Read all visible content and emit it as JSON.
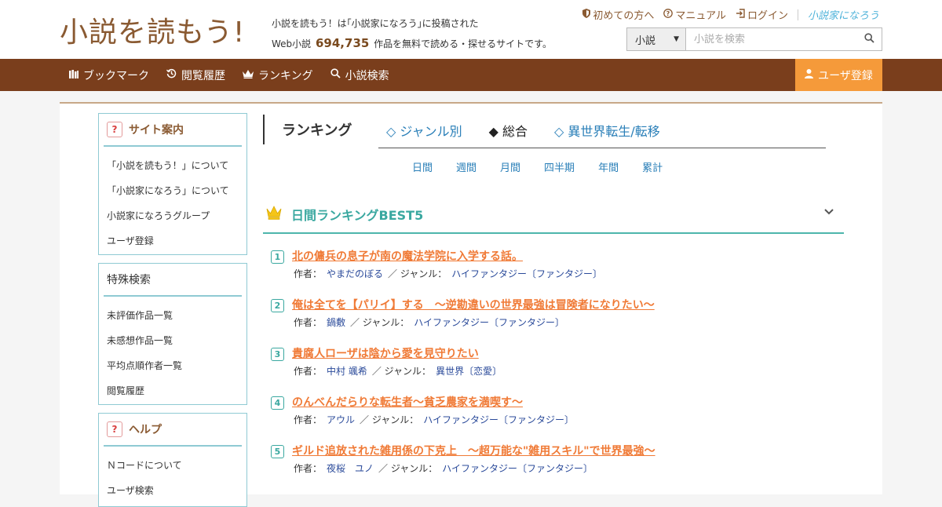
{
  "header": {
    "logo": "小説を読もう!",
    "tagline_line1": "小説を読もう！は｢小説家になろう｣に投稿された",
    "tagline_prefix": "Web小説",
    "novel_count": "694,735",
    "tagline_suffix": "作品を無料で読める・探せるサイトです。",
    "links": {
      "first_time": "初めての方へ",
      "manual": "マニュアル",
      "login": "ログイン",
      "partner": "小説家になろう"
    },
    "search": {
      "category": "小説",
      "placeholder": "小説を検索"
    }
  },
  "nav": {
    "items": [
      "ブックマーク",
      "閲覧履歴",
      "ランキング",
      "小説検索"
    ],
    "register": "ユーザ登録"
  },
  "sidebar": {
    "box1": {
      "title": "サイト案内",
      "items": [
        "「小説を読もう！」について",
        "「小説家になろう」について",
        "小説家になろうグループ",
        "ユーザ登録"
      ]
    },
    "box2": {
      "title": "特殊検索",
      "items": [
        "未評価作品一覧",
        "未感想作品一覧",
        "平均点順作者一覧",
        "閲覧履歴"
      ]
    },
    "box3": {
      "title": "ヘルプ",
      "items": [
        "Ｎコードについて",
        "ユーザ検索"
      ]
    }
  },
  "ranking": {
    "title": "ランキング",
    "tabs": [
      "◇ ジャンル別",
      "◆ 総合",
      "◇ 異世界転生/転移"
    ],
    "periods": [
      "日間",
      "週間",
      "月間",
      "四半期",
      "年間",
      "累計"
    ],
    "best_title": "日間ランキングBEST5",
    "author_label": "作者：",
    "genre_label": "／ ジャンル：",
    "entries": [
      {
        "rank": "1",
        "title": "北の傭兵の息子が南の魔法学院に入学する話。",
        "author": "やまだのぼる",
        "genre": "ハイファンタジー〔ファンタジー〕"
      },
      {
        "rank": "2",
        "title": "俺は全てを【パリイ】する　〜逆勘違いの世界最強は冒険者になりたい〜",
        "author": "鍋敷",
        "genre": "ハイファンタジー〔ファンタジー〕"
      },
      {
        "rank": "3",
        "title": "貴腐人ローザは陰から愛を見守りたい",
        "author": "中村 颯希",
        "genre": "異世界〔恋愛〕"
      },
      {
        "rank": "4",
        "title": "のんべんだらりな転生者～貧乏農家を満喫す～",
        "author": "アウル",
        "genre": "ハイファンタジー〔ファンタジー〕"
      },
      {
        "rank": "5",
        "title": "ギルド追放された雑用係の下克上　～超万能な\"雑用スキル\"で世界最強～",
        "author": "夜桜　ユノ",
        "genre": "ハイファンタジー〔ファンタジー〕"
      }
    ]
  },
  "colors": {
    "brand_brown": "#7a3e1c",
    "accent_orange": "#f59a3a",
    "teal": "#3aa8a0",
    "title_orange": "#f07a36"
  }
}
